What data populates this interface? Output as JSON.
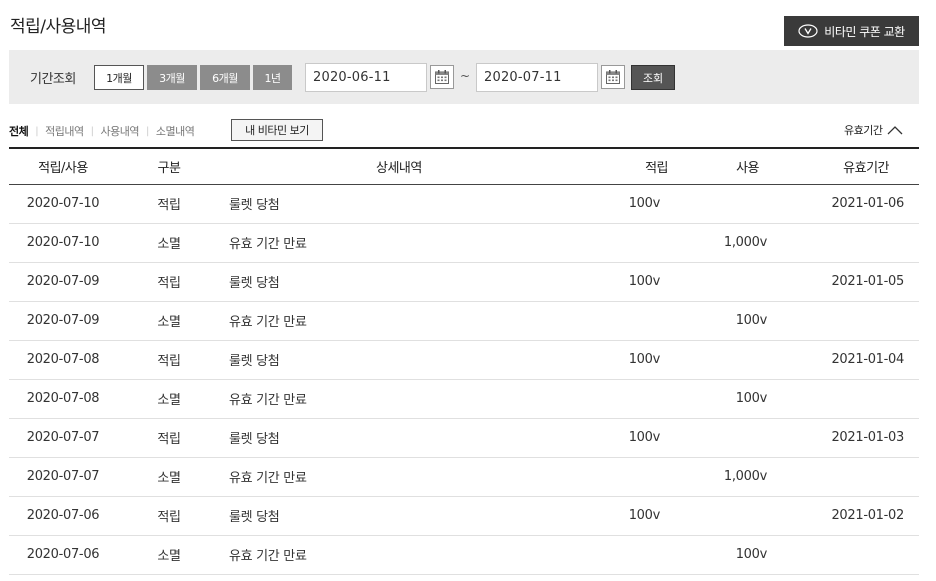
{
  "header": {
    "title": "적립/사용내역",
    "coupon_button": "비타민 쿠폰 교환"
  },
  "search": {
    "label": "기간조회",
    "periods": [
      "1개월",
      "3개월",
      "6개월",
      "1년"
    ],
    "active_period": "1개월",
    "start_date": "2020-06-11",
    "separator": "~",
    "end_date": "2020-07-11",
    "submit_label": "조회"
  },
  "filters": {
    "tabs": [
      "전체",
      "적립내역",
      "사용내역",
      "소멸내역"
    ],
    "active_tab": "전체",
    "my_vitamin_button": "내 비타민 보기",
    "sort_label": "유효기간"
  },
  "table": {
    "headers": [
      "적립/사용",
      "구분",
      "상세내역",
      "적립",
      "사용",
      "유효기간"
    ],
    "rows": [
      {
        "date": "2020-07-10",
        "type": "적립",
        "detail": "룰렛 당첨",
        "earn": "100v",
        "use": "",
        "expiry": "2021-01-06"
      },
      {
        "date": "2020-07-10",
        "type": "소멸",
        "detail": "유효 기간 만료",
        "earn": "",
        "use": "1,000v",
        "expiry": ""
      },
      {
        "date": "2020-07-09",
        "type": "적립",
        "detail": "룰렛 당첨",
        "earn": "100v",
        "use": "",
        "expiry": "2021-01-05"
      },
      {
        "date": "2020-07-09",
        "type": "소멸",
        "detail": "유효 기간 만료",
        "earn": "",
        "use": "100v",
        "expiry": ""
      },
      {
        "date": "2020-07-08",
        "type": "적립",
        "detail": "룰렛 당첨",
        "earn": "100v",
        "use": "",
        "expiry": "2021-01-04"
      },
      {
        "date": "2020-07-08",
        "type": "소멸",
        "detail": "유효 기간 만료",
        "earn": "",
        "use": "100v",
        "expiry": ""
      },
      {
        "date": "2020-07-07",
        "type": "적립",
        "detail": "룰렛 당첨",
        "earn": "100v",
        "use": "",
        "expiry": "2021-01-03"
      },
      {
        "date": "2020-07-07",
        "type": "소멸",
        "detail": "유효 기간 만료",
        "earn": "",
        "use": "1,000v",
        "expiry": ""
      },
      {
        "date": "2020-07-06",
        "type": "적립",
        "detail": "룰렛 당첨",
        "earn": "100v",
        "use": "",
        "expiry": "2021-01-02"
      },
      {
        "date": "2020-07-06",
        "type": "소멸",
        "detail": "유효 기간 만료",
        "earn": "",
        "use": "100v",
        "expiry": ""
      }
    ]
  },
  "icons": {
    "coupon": "vitamin-v-icon",
    "calendar": "calendar-icon",
    "sort": "chevron-up-icon"
  },
  "colors": {
    "dark_button": "#3a3a3a",
    "inactive_period": "#8c8c8c",
    "search_bg": "#ececec"
  }
}
